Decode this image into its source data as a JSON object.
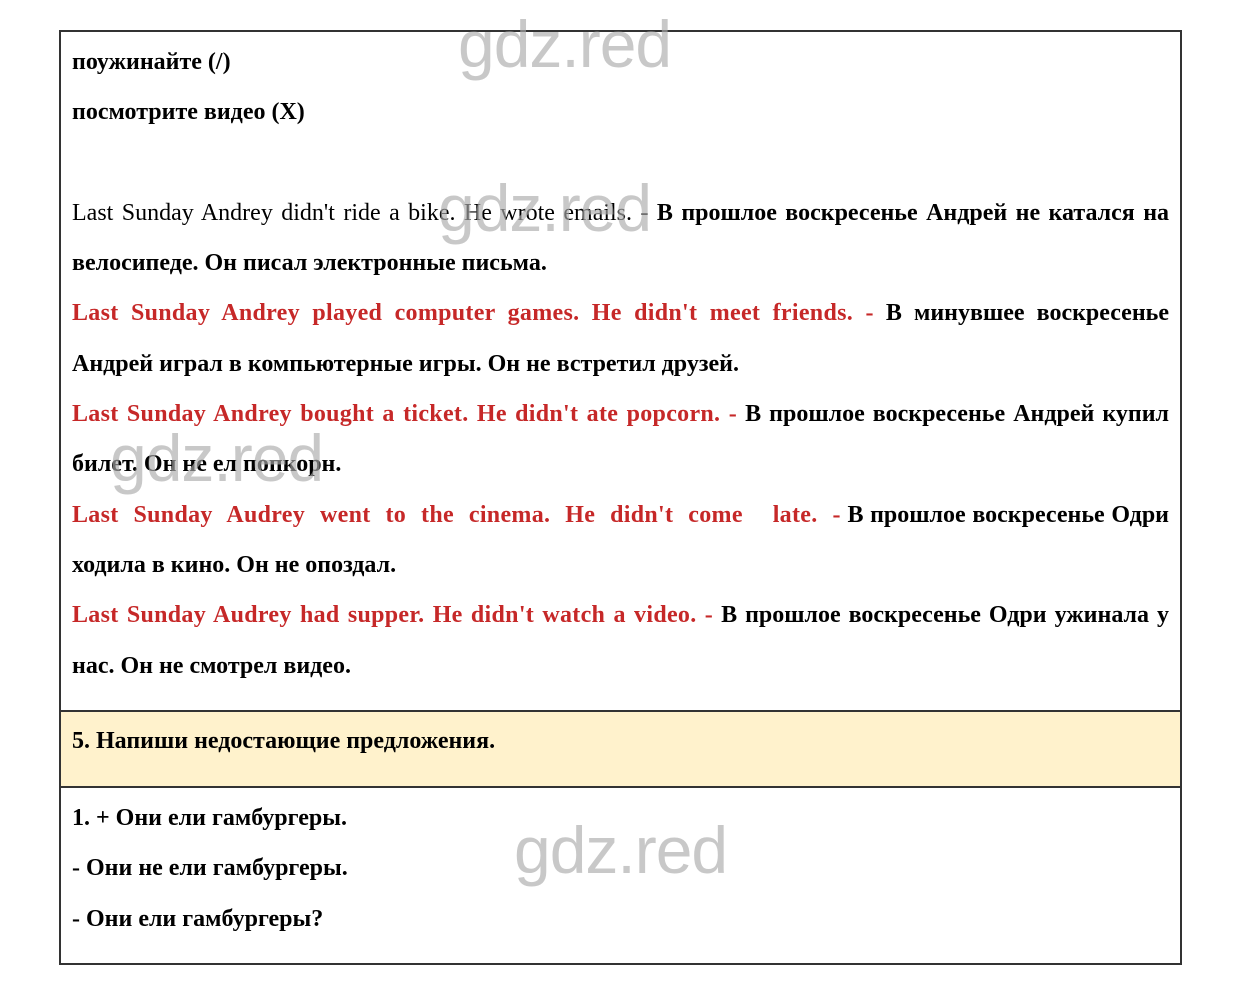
{
  "top_lines": [
    "поужинайте (/)",
    "посмотрите видео (X)"
  ],
  "paragraphs": [
    {
      "english": "Last Sunday Andrey didn't ride a bike. He wrote emails. -",
      "russian": "В прошлое воскресенье Андрей не катался на велосипеде. Он писал электронные письма.",
      "style": "plain"
    },
    {
      "english": "Last Sunday Andrey played computer games. He didn't meet friends. -",
      "russian": "В минувшее воскресенье Андрей играл в компьютерные игры. Он не встретил друзей.",
      "style": "red"
    },
    {
      "english": "Last Sunday Andrey bought a ticket. He didn't ate popcorn. -",
      "russian": "В прошлое воскресенье Андрей купил билет. Он не ел попкорн.",
      "style": "red"
    },
    {
      "english": "Last Sunday Audrey went to the cinema. He didn't come  late. -",
      "russian": "В прошлое воскресенье Одри ходила в кино. Он не опоздал.",
      "style": "red"
    },
    {
      "english": "Last Sunday Audrey had supper. He didn't watch a video. -",
      "russian": "В прошлое воскресенье Одри ужинала у нас. Он не смотрел видео.",
      "style": "red"
    }
  ],
  "task_header": "5. Напиши недостающие предложения.",
  "answers": [
    "1. + Они ели гамбургеры.",
    "- Они не ели гамбургеры.",
    "- Они ели гамбургеры?"
  ],
  "watermark": "gdz.red",
  "colors": {
    "english_highlight": "#c62828",
    "header_bg": "#fff2cc",
    "border": "#333333"
  }
}
